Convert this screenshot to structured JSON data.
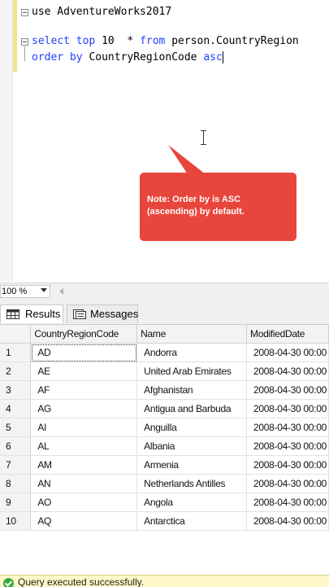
{
  "editor": {
    "lines": [
      {
        "parts": [
          {
            "t": "use AdventureWorks2017",
            "c": ""
          }
        ]
      },
      {
        "parts": [
          {
            "t": "select",
            "c": "kw"
          },
          {
            "t": " ",
            "c": ""
          },
          {
            "t": "top",
            "c": "kw"
          },
          {
            "t": " 10  * ",
            "c": ""
          },
          {
            "t": "from",
            "c": "kw"
          },
          {
            "t": " person.CountryRegion",
            "c": ""
          }
        ]
      },
      {
        "parts": [
          {
            "t": "order by",
            "c": "kw"
          },
          {
            "t": " CountryRegionCode ",
            "c": ""
          },
          {
            "t": "asc",
            "c": "kw"
          }
        ]
      }
    ],
    "keyword_color": "#1f3fff"
  },
  "callout": {
    "text": "Note: Order by is ASC (ascending) by default.",
    "color": "#e8453c"
  },
  "zoom": {
    "value": "100 %"
  },
  "tabs": [
    {
      "label": "Results",
      "icon": "grid-icon"
    },
    {
      "label": "Messages",
      "icon": "messages-icon"
    }
  ],
  "grid": {
    "columns": [
      "CountryRegionCode",
      "Name",
      "ModifiedDate"
    ],
    "rows": [
      {
        "n": "1",
        "code": "AD",
        "name": "Andorra",
        "date": "2008-04-30 00:00"
      },
      {
        "n": "2",
        "code": "AE",
        "name": "United Arab Emirates",
        "date": "2008-04-30 00:00"
      },
      {
        "n": "3",
        "code": "AF",
        "name": "Afghanistan",
        "date": "2008-04-30 00:00"
      },
      {
        "n": "4",
        "code": "AG",
        "name": "Antigua and Barbuda",
        "date": "2008-04-30 00:00"
      },
      {
        "n": "5",
        "code": "AI",
        "name": "Anguilla",
        "date": "2008-04-30 00:00"
      },
      {
        "n": "6",
        "code": "AL",
        "name": "Albania",
        "date": "2008-04-30 00:00"
      },
      {
        "n": "7",
        "code": "AM",
        "name": "Armenia",
        "date": "2008-04-30 00:00"
      },
      {
        "n": "8",
        "code": "AN",
        "name": "Netherlands Antilles",
        "date": "2008-04-30 00:00"
      },
      {
        "n": "9",
        "code": "AO",
        "name": "Angola",
        "date": "2008-04-30 00:00"
      },
      {
        "n": "10",
        "code": "AQ",
        "name": "Antarctica",
        "date": "2008-04-30 00:00"
      }
    ]
  },
  "status": {
    "text": "Query executed successfully.",
    "icon": "success-check-icon",
    "color": "#3aa846"
  }
}
